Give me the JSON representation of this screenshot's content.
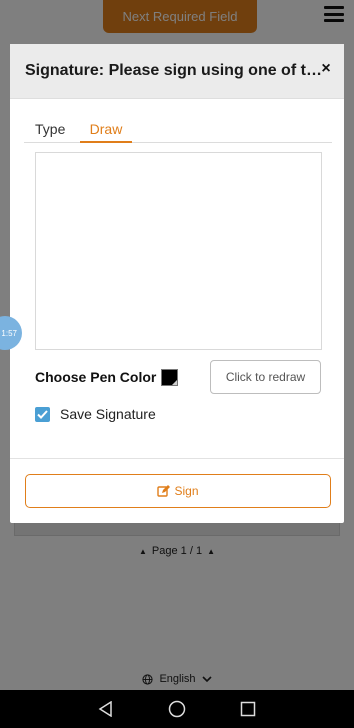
{
  "topbar": {
    "next_field_label": "Next Required Field"
  },
  "timer": {
    "text": "1:57"
  },
  "modal": {
    "title": "Signature: Please sign using one of the options below",
    "close_symbol": "×",
    "tabs": [
      {
        "label": "Type",
        "active": false
      },
      {
        "label": "Draw",
        "active": true
      }
    ],
    "pen_color_label": "Choose Pen Color",
    "pen_color": "#000000",
    "redraw_label": "Click to redraw",
    "save_signature_label": "Save Signature",
    "save_signature_checked": true,
    "sign_label": "Sign",
    "sign_icon": "edit-icon"
  },
  "pagination": {
    "text": "Page 1 / 1"
  },
  "language": {
    "selected": "English",
    "icon": "globe-icon"
  },
  "colors": {
    "accent": "#e07e1a",
    "checkbox": "#4a9fd4",
    "timer": "#7bb3e0"
  }
}
